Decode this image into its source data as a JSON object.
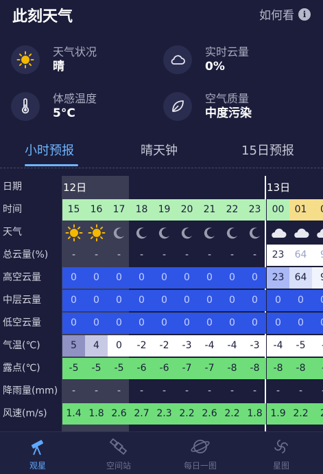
{
  "header": {
    "title": "此刻天气",
    "help_label": "如何看",
    "help_icon": "info-icon"
  },
  "stats": [
    {
      "icon": "sun-icon",
      "label": "天气状况",
      "value": "晴"
    },
    {
      "icon": "cloud-icon",
      "label": "实时云量",
      "value": "0%"
    },
    {
      "icon": "thermometer-icon",
      "label": "体感温度",
      "value": "5°C"
    },
    {
      "icon": "leaf-icon",
      "label": "空气质量",
      "value": "中度污染"
    }
  ],
  "tabs": [
    "小时预报",
    "晴天钟",
    "15日预报"
  ],
  "active_tab": 0,
  "forecast": {
    "row_labels": [
      "日期",
      "时间",
      "天气",
      "总云量(%)",
      "高空云量",
      "中层云量",
      "低空云量",
      "气温(℃)",
      "露点(℃)",
      "降雨量(mm)",
      "风速(m/s)"
    ],
    "day1": "12日",
    "day2": "13日",
    "hours": [
      "15",
      "16",
      "17",
      "18",
      "19",
      "20",
      "21",
      "22",
      "23",
      "00",
      "01",
      "0"
    ],
    "weather": [
      "sun",
      "sun",
      "moon",
      "moon",
      "moon",
      "moon",
      "moon",
      "moon",
      "moon",
      "cloud",
      "cloud",
      "cloud"
    ],
    "total_cloud": [
      "-",
      "-",
      "-",
      "-",
      "-",
      "-",
      "-",
      "-",
      "-",
      "23",
      "64",
      "9"
    ],
    "high_cloud": [
      "0",
      "0",
      "0",
      "0",
      "0",
      "0",
      "0",
      "0",
      "0",
      "23",
      "64",
      "9"
    ],
    "mid_cloud": [
      "0",
      "0",
      "0",
      "0",
      "0",
      "0",
      "0",
      "0",
      "0",
      "0",
      "0",
      "0"
    ],
    "low_cloud": [
      "0",
      "0",
      "0",
      "0",
      "0",
      "0",
      "0",
      "0",
      "0",
      "0",
      "0",
      "0"
    ],
    "temp": [
      "5",
      "4",
      "0",
      "-2",
      "-2",
      "-3",
      "-4",
      "-4",
      "-3",
      "-4",
      "-5",
      "-"
    ],
    "dew": [
      "-5",
      "-5",
      "-5",
      "-6",
      "-6",
      "-7",
      "-7",
      "-8",
      "-8",
      "-8",
      "-8",
      "-"
    ],
    "rain": [
      "-",
      "-",
      "-",
      "-",
      "-",
      "-",
      "-",
      "-",
      "-",
      "-",
      "-",
      "-"
    ],
    "wind": [
      "1.4",
      "1.8",
      "2.6",
      "2.7",
      "2.3",
      "2.2",
      "2.6",
      "2.2",
      "1.8",
      "1.9",
      "2.2",
      "2"
    ]
  },
  "colors": {
    "hour_green": "#b3f0b6",
    "hour_yellow": "#f5dd8a",
    "cloud_blue": "#2f55e6",
    "green": "#6fde7a",
    "accent": "#6fb6ff"
  },
  "nav": [
    {
      "icon": "telescope-icon",
      "label": "观星"
    },
    {
      "icon": "satellite-icon",
      "label": "空间站"
    },
    {
      "icon": "planet-icon",
      "label": "每日一图"
    },
    {
      "icon": "galaxy-icon",
      "label": "星图"
    }
  ],
  "active_nav": 0
}
